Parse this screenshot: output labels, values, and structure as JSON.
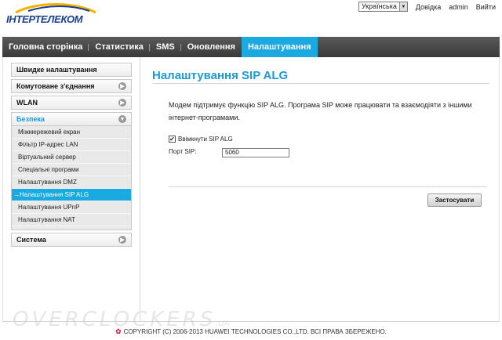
{
  "brand": {
    "logo_text": "ІНТЕРТЕЛЕКОМ"
  },
  "topbar": {
    "language": "Українська",
    "help": "Довідка",
    "user": "admin",
    "logout": "Вийти"
  },
  "nav": {
    "tabs": [
      {
        "label": "Головна сторінка"
      },
      {
        "label": "Статистика"
      },
      {
        "label": "SMS"
      },
      {
        "label": "Оновлення"
      },
      {
        "label": "Налаштування",
        "active": true
      }
    ]
  },
  "sidebar": {
    "groups": [
      {
        "label": "Швидке налаштування"
      },
      {
        "label": "Комутоване з'єднання"
      },
      {
        "label": "WLAN"
      },
      {
        "label": "Безпека",
        "open": true
      },
      {
        "label": "Система"
      }
    ],
    "security_items": [
      {
        "label": "Міжмережевий екран"
      },
      {
        "label": "Фільтр IP-адрес LAN"
      },
      {
        "label": "Віртуальний сервер"
      },
      {
        "label": "Спеціальні програми"
      },
      {
        "label": "Налаштування DMZ"
      },
      {
        "label": "→Налаштування SIP ALG",
        "active": true
      },
      {
        "label": "Налаштування UPnP"
      },
      {
        "label": "Налаштування NAT"
      }
    ]
  },
  "content": {
    "title": "Налаштування SIP ALG",
    "description": "Модем підтримує функцію SIP ALG. Програма SIP може працювати та взаємодіяти з іншими інтернет-програмами.",
    "enable_label": "Ввімкнути SIP ALG",
    "enable_checked": true,
    "port_label": "Порт SIP:",
    "port_value": "5060",
    "apply_label": "Застосувати"
  },
  "watermark": {
    "text": "OVERCLOCKERS",
    "suffix": ".UA"
  },
  "footer": {
    "copyright": "COPYRIGHT (C) 2006-2013 HUAWEI TECHNOLOGIES CO.,LTD. ВСІ ПРАВА ЗБЕРЕЖЕНО."
  },
  "colors": {
    "accent": "#1aa9e0",
    "nav_bg": "#4a4a4a",
    "title": "#1a9ad6",
    "brand": "#1a3f8f",
    "huawei": "#c8102e"
  }
}
